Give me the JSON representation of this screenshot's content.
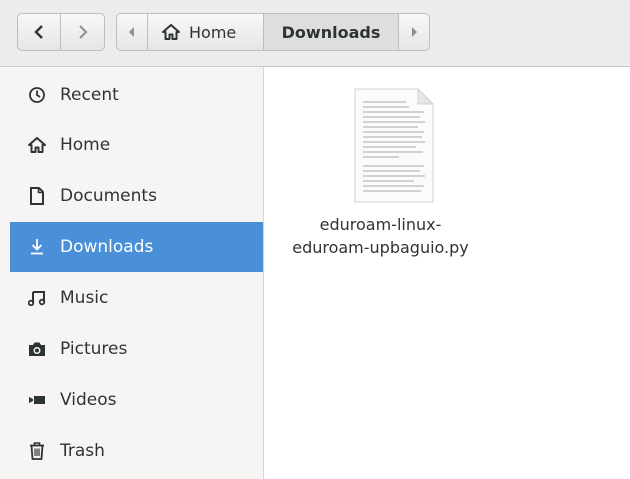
{
  "header": {
    "back_icon": "chevron-left-icon",
    "forward_icon": "chevron-right-icon",
    "path": {
      "scroll_left_icon": "triangle-left-icon",
      "home_label": "Home",
      "home_icon": "home-icon",
      "current_label": "Downloads",
      "scroll_right_icon": "triangle-right-icon"
    }
  },
  "sidebar": {
    "items": [
      {
        "label": "Recent",
        "icon": "clock-icon"
      },
      {
        "label": "Home",
        "icon": "home-icon"
      },
      {
        "label": "Documents",
        "icon": "document-icon"
      },
      {
        "label": "Downloads",
        "icon": "download-arrow-icon",
        "active": true
      },
      {
        "label": "Music",
        "icon": "music-note-icon"
      },
      {
        "label": "Pictures",
        "icon": "camera-icon"
      },
      {
        "label": "Videos",
        "icon": "video-camera-icon"
      },
      {
        "label": "Trash",
        "icon": "trash-icon"
      }
    ]
  },
  "files": [
    {
      "name_line1": "eduroam-linux-",
      "name_line2": "eduroam-upbaguio.py",
      "icon": "text-document-icon"
    }
  ],
  "colors": {
    "accent": "#4a90d9",
    "sidebar_bg": "#f6f5f4",
    "header_bg": "#ececec",
    "text": "#2e3436"
  }
}
